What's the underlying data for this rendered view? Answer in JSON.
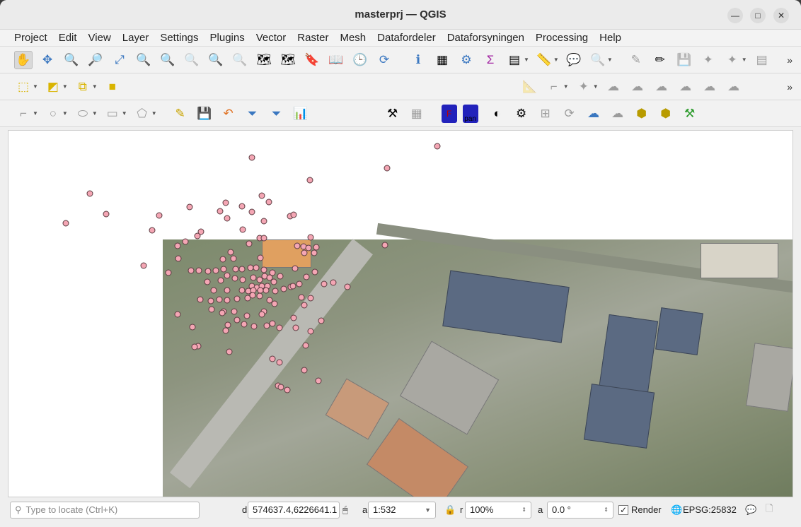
{
  "window": {
    "title": "masterprj — QGIS"
  },
  "menu": [
    "Project",
    "Edit",
    "View",
    "Layer",
    "Settings",
    "Plugins",
    "Vector",
    "Raster",
    "Mesh",
    "Datafordeler",
    "Dataforsyningen",
    "Processing",
    "Help"
  ],
  "plugins": {
    "f1": "F",
    "f2": "pan"
  },
  "status": {
    "locate_placeholder": "Type to locate (Ctrl+K)",
    "coord_label": "d",
    "coordinate": "574637.4,6226641.1",
    "scale_label": "a",
    "scale": "1:532",
    "mag_label": "r",
    "magnifier": "100%",
    "rot_label": "a",
    "rotation": "0.0 °",
    "render_label": "Render",
    "render_checked": true,
    "crs": "EPSG:25832"
  }
}
